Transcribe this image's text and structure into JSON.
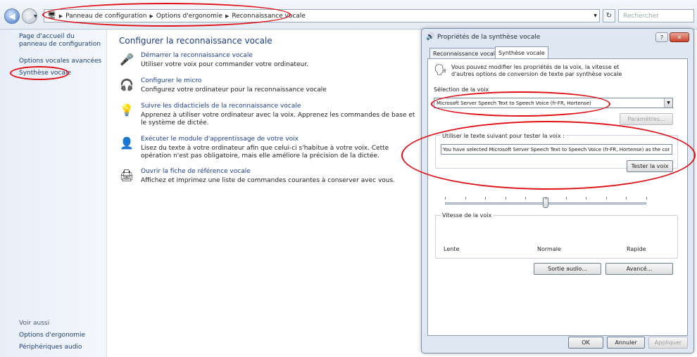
{
  "address_bar": {
    "breadcrumbs": [
      "Panneau de configuration",
      "Options d'ergonomie",
      "Reconnaissance vocale"
    ],
    "search_placeholder": "Rechercher"
  },
  "left_nav": {
    "items": [
      "Page d'accueil du panneau de configuration",
      "Options vocales avancées",
      "Synthèse vocale"
    ],
    "see_also_heading": "Voir aussi",
    "see_also": [
      "Options d'ergonomie",
      "Périphériques audio"
    ]
  },
  "main": {
    "title": "Configurer la reconnaissance vocale",
    "tasks": [
      {
        "icon": "microphone-icon",
        "link": "Démarrer la reconnaissance vocale",
        "desc": "Utiliser votre voix pour commander votre ordinateur."
      },
      {
        "icon": "headset-icon",
        "link": "Configurer le micro",
        "desc": "Configurez votre ordinateur pour la reconnaissance vocale"
      },
      {
        "icon": "lightbulb-icon",
        "link": "Suivre les didacticiels de la reconnaissance vocale",
        "desc": "Apprenez à utiliser votre ordinateur avec la voix. Apprenez les commandes de base et le système de dictée."
      },
      {
        "icon": "person-icon",
        "link": "Exécuter le module d'apprentissage de votre voix",
        "desc": "Lisez du texte à votre ordinateur afin que celui-ci s'habitue à votre voix. Cette opération n'est pas obligatoire, mais elle améliore la précision de la dictée."
      },
      {
        "icon": "printer-icon",
        "link": "Ouvrir la fiche de référence vocale",
        "desc": "Affichez et imprimez une liste de commandes courantes à conserver avec vous."
      }
    ]
  },
  "dialog": {
    "title": "Propriétés de la synthèse vocale",
    "help_glyph": "?",
    "close_glyph": "✕",
    "tabs": [
      "Reconnaissance vocale",
      "Synthèse vocale"
    ],
    "active_tab": 1,
    "intro": "Vous pouvez modifier les propriétés de la voix, la vitesse et d'autres options de conversion de texte par synthèse vocale",
    "voice_group_label": "Sélection de la voix",
    "voice_selected": "Microsoft Server Speech Text to Speech Voice (fr-FR, Hortense)",
    "settings_button": "Paramètres...",
    "test_label": "Utiliser le texte suivant pour tester la voix :",
    "test_text": "You have selected Microsoft Server Speech Text to Speech Voice (fr-FR, Hortense) as the cor",
    "test_button": "Tester la voix",
    "speed_label": "Vitesse de la voix",
    "speed_value": 0.5,
    "speed_min": "Lente",
    "speed_mid": "Normale",
    "speed_max": "Rapide",
    "audio_button": "Sortie audio...",
    "advanced_button": "Avancé...",
    "ok_button": "OK",
    "cancel_button": "Annuler",
    "apply_button": "Appliquer"
  },
  "colors": {
    "highlight": "#e10f14",
    "link": "#1c3f99"
  }
}
